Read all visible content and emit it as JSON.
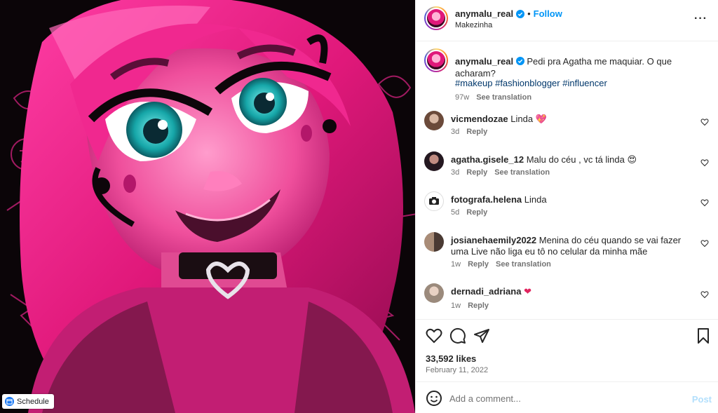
{
  "media": {
    "schedule_label": "Schedule"
  },
  "header": {
    "username": "anymalu_real",
    "separator": "•",
    "follow_label": "Follow",
    "subtitle": "Makezinha",
    "more_icon": "more-horizontal-icon"
  },
  "caption": {
    "username": "anymalu_real",
    "text": "Pedi pra Agatha me maquiar. O que acharam?",
    "hashtags": "#makeup #fashionblogger #influencer",
    "time": "97w",
    "see_translation": "See translation"
  },
  "comments": [
    {
      "username": "vicmendozae",
      "text": "Linda",
      "emoji": "💖",
      "time": "3d",
      "reply": "Reply",
      "see_translation": ""
    },
    {
      "username": "agatha.gisele_12",
      "text": "Malu do céu , vc tá linda",
      "emoji": "😍",
      "time": "3d",
      "reply": "Reply",
      "see_translation": "See translation"
    },
    {
      "username": "fotografa.helena",
      "text": "Linda",
      "emoji": "",
      "time": "5d",
      "reply": "Reply",
      "see_translation": ""
    },
    {
      "username": "josianehaemily2022",
      "text": "Menina do céu quando se vai fazer uma Live não liga eu tô no celular da minha mãe",
      "emoji": "",
      "time": "1w",
      "reply": "Reply",
      "see_translation": "See translation"
    },
    {
      "username": "dernadi_adriana",
      "text": "",
      "emoji": "❤",
      "time": "1w",
      "reply": "Reply",
      "see_translation": ""
    }
  ],
  "actions": {
    "likes": "33,592 likes",
    "date": "February 11, 2022",
    "icons": [
      "heart-icon",
      "comment-icon",
      "share-icon",
      "bookmark-icon"
    ]
  },
  "add_comment": {
    "placeholder": "Add a comment...",
    "post_label": "Post"
  },
  "colors": {
    "accent": "#0095f6",
    "verified": "#0095f6",
    "hashtag": "#00376b",
    "muted": "#737373",
    "art_pink": "#e0187a"
  }
}
